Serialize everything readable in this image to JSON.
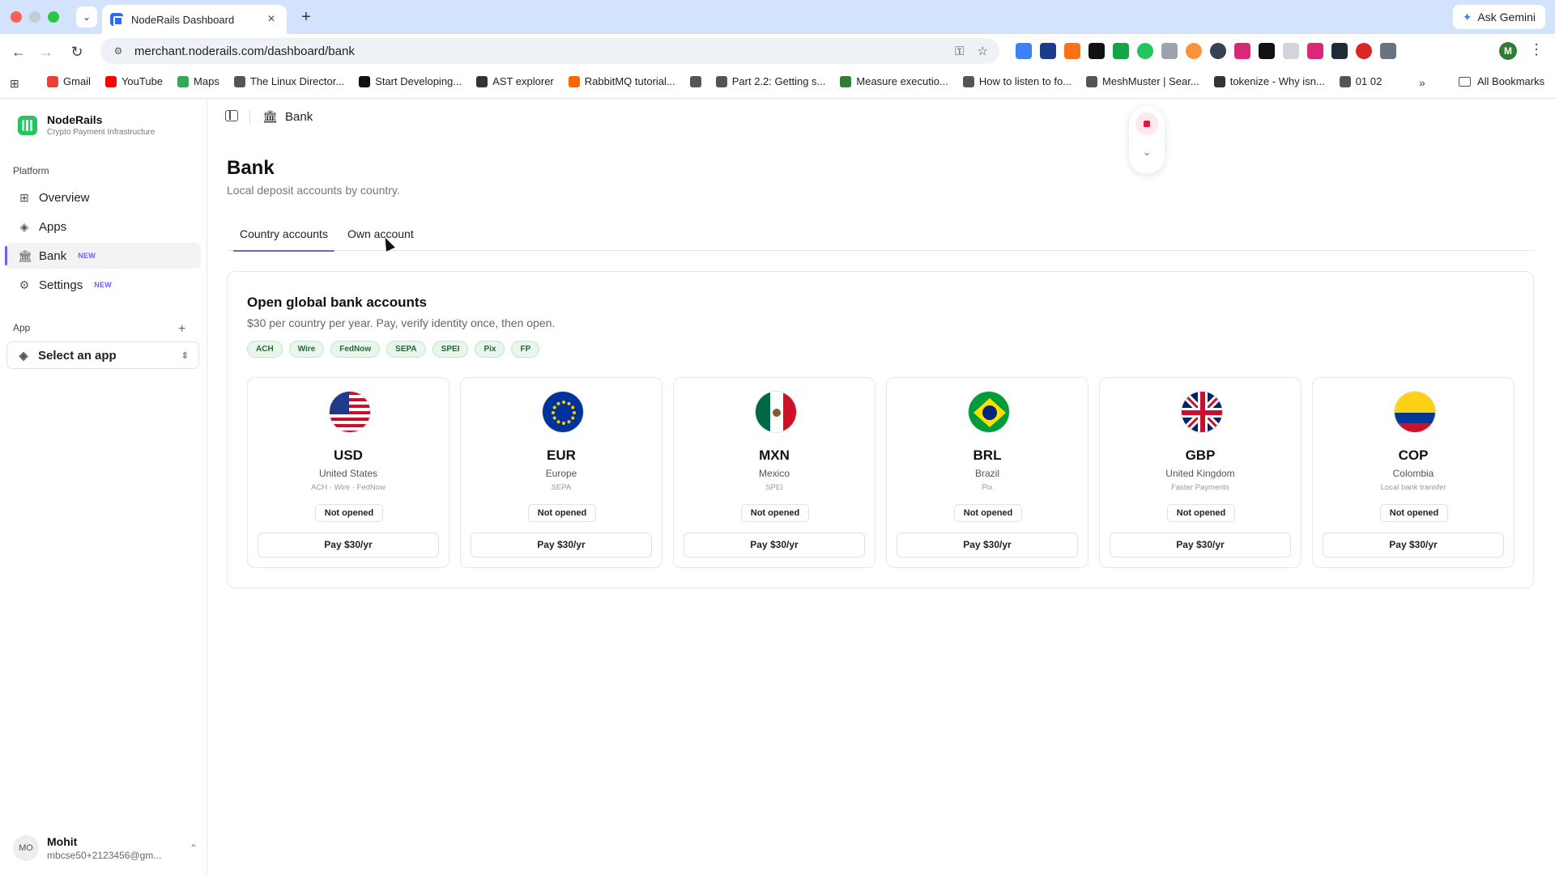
{
  "browser": {
    "tab_title": "NodeRails Dashboard",
    "url": "merchant.noderails.com/dashboard/bank",
    "ask_gemini": "Ask Gemini",
    "profile_initial": "M",
    "bookmarks": [
      {
        "label": "Gmail",
        "color": "#ea4335"
      },
      {
        "label": "YouTube",
        "color": "#ff0000"
      },
      {
        "label": "Maps",
        "color": "#34a853"
      },
      {
        "label": "The Linux Director...",
        "color": "#555555"
      },
      {
        "label": "Start Developing...",
        "color": "#111111"
      },
      {
        "label": "AST explorer",
        "color": "#333333"
      },
      {
        "label": "RabbitMQ tutorial...",
        "color": "#f60"
      },
      {
        "label": "",
        "color": "#555555"
      },
      {
        "label": "Part 2.2: Getting s...",
        "color": "#555555"
      },
      {
        "label": "Measure executio...",
        "color": "#2e7d32"
      },
      {
        "label": "How to listen to fo...",
        "color": "#555555"
      },
      {
        "label": "MeshMuster | Sear...",
        "color": "#555555"
      },
      {
        "label": "tokenize - Why isn...",
        "color": "#333333"
      },
      {
        "label": "01 02",
        "color": "#555555"
      }
    ],
    "all_bookmarks": "All Bookmarks"
  },
  "sidebar": {
    "brand_name": "NodeRails",
    "brand_sub": "Crypto Payment Infrastructure",
    "platform_label": "Platform",
    "items": [
      {
        "label": "Overview",
        "badge": ""
      },
      {
        "label": "Apps",
        "badge": ""
      },
      {
        "label": "Bank",
        "badge": "NEW"
      },
      {
        "label": "Settings",
        "badge": "NEW"
      }
    ],
    "app_label": "App",
    "app_select": "Select an app",
    "user": {
      "initials": "MO",
      "name": "Mohit",
      "email": "mbcse50+2123456@gm..."
    }
  },
  "topbar": {
    "crumb": "Bank"
  },
  "page": {
    "title": "Bank",
    "subtitle": "Local deposit accounts by country.",
    "tabs": [
      {
        "label": "Country accounts"
      },
      {
        "label": "Own account"
      }
    ]
  },
  "panel": {
    "title": "Open global bank accounts",
    "subtitle": "$30 per country per year. Pay, verify identity once, then open.",
    "rails": [
      "ACH",
      "Wire",
      "FedNow",
      "SEPA",
      "SPEI",
      "Pix",
      "FP"
    ],
    "cards": [
      {
        "code": "USD",
        "country": "United States",
        "rails": "ACH · Wire · FedNow",
        "status": "Not opened",
        "pay": "Pay $30/yr"
      },
      {
        "code": "EUR",
        "country": "Europe",
        "rails": "SEPA",
        "status": "Not opened",
        "pay": "Pay $30/yr"
      },
      {
        "code": "MXN",
        "country": "Mexico",
        "rails": "SPEI",
        "status": "Not opened",
        "pay": "Pay $30/yr"
      },
      {
        "code": "BRL",
        "country": "Brazil",
        "rails": "Pix",
        "status": "Not opened",
        "pay": "Pay $30/yr"
      },
      {
        "code": "GBP",
        "country": "United Kingdom",
        "rails": "Faster Payments",
        "status": "Not opened",
        "pay": "Pay $30/yr"
      },
      {
        "code": "COP",
        "country": "Colombia",
        "rails": "Local bank transfer",
        "status": "Not opened",
        "pay": "Pay $30/yr"
      }
    ]
  },
  "colors": {
    "accent": "#6d5df5",
    "brand": "#22c55e",
    "rail_bg": "#e8f6ec",
    "record": "#e5143f"
  }
}
